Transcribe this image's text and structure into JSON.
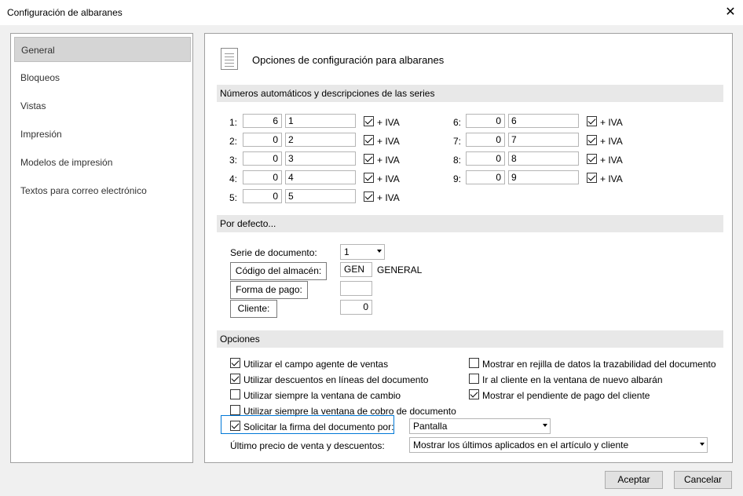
{
  "window": {
    "title": "Configuración de albaranes"
  },
  "sidebar": {
    "items": [
      {
        "label": "General"
      },
      {
        "label": "Bloqueos"
      },
      {
        "label": "Vistas"
      },
      {
        "label": "Impresión"
      },
      {
        "label": "Modelos de impresión"
      },
      {
        "label": "Textos para correo electrónico"
      }
    ]
  },
  "header": {
    "title": "Opciones de configuración para albaranes"
  },
  "sections": {
    "series": "Números automáticos y descripciones de las series",
    "defaults": "Por defecto...",
    "options": "Opciones"
  },
  "series": {
    "iva_label": "+ IVA",
    "left": [
      {
        "label": "1:",
        "number": "6",
        "desc": "1",
        "iva": true
      },
      {
        "label": "2:",
        "number": "0",
        "desc": "2",
        "iva": true
      },
      {
        "label": "3:",
        "number": "0",
        "desc": "3",
        "iva": true
      },
      {
        "label": "4:",
        "number": "0",
        "desc": "4",
        "iva": true
      },
      {
        "label": "5:",
        "number": "0",
        "desc": "5",
        "iva": true
      }
    ],
    "right": [
      {
        "label": "6:",
        "number": "0",
        "desc": "6",
        "iva": true
      },
      {
        "label": "7:",
        "number": "0",
        "desc": "7",
        "iva": true
      },
      {
        "label": "8:",
        "number": "0",
        "desc": "8",
        "iva": true
      },
      {
        "label": "9:",
        "number": "0",
        "desc": "9",
        "iva": true
      }
    ]
  },
  "defaults": {
    "serie_label": "Serie de documento:",
    "serie_value": "1",
    "almacen_button": "Código del almacén:",
    "almacen_code": "GEN",
    "almacen_name": "GENERAL",
    "pago_button": "Forma de pago:",
    "pago_value": "",
    "cliente_button": "Cliente:",
    "cliente_value": "0"
  },
  "options": {
    "left": [
      {
        "label": "Utilizar el campo agente de ventas",
        "checked": true
      },
      {
        "label": "Utilizar descuentos en líneas del documento",
        "checked": true
      },
      {
        "label": "Utilizar siempre la ventana de cambio",
        "checked": false
      },
      {
        "label": "Utilizar siempre la ventana de cobro de documento",
        "checked": false
      },
      {
        "label": "Solicitar la firma del documento por:",
        "checked": true
      }
    ],
    "right": [
      {
        "label": "Mostrar en rejilla de datos la trazabilidad del documento",
        "checked": false
      },
      {
        "label": "Ir al cliente en la ventana de nuevo albarán",
        "checked": false
      },
      {
        "label": "Mostrar el pendiente de pago del cliente",
        "checked": true
      }
    ],
    "firma_value": "Pantalla",
    "precio_label": "Último precio de venta y descuentos:",
    "precio_value": "Mostrar los últimos aplicados en el artículo y cliente"
  },
  "footer": {
    "accept": "Aceptar",
    "cancel": "Cancelar"
  }
}
